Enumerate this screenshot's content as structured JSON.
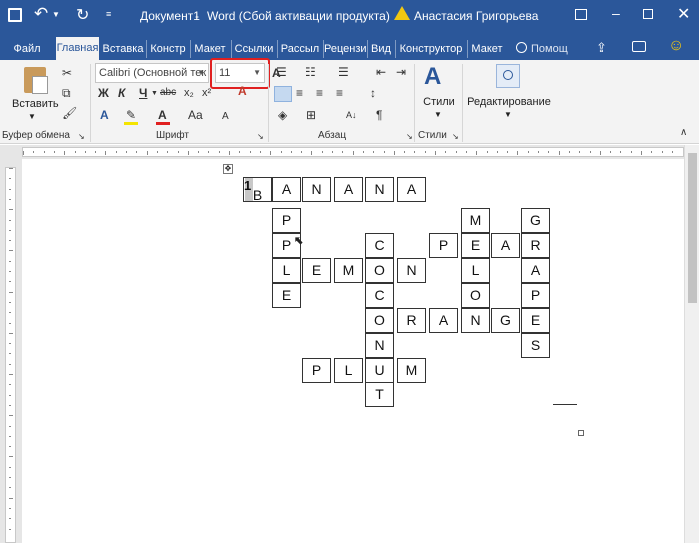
{
  "window": {
    "doc_title": "Документ1",
    "app_title": "Word (Сбой активации продукта)",
    "user_name": "Анастасия Григорьева"
  },
  "tabs": [
    "Файл",
    "Главная",
    "Вставка",
    "Констр",
    "Макет",
    "Ссылки",
    "Рассыл",
    "Рецензи",
    "Вид",
    "Конструктор",
    "Макет"
  ],
  "active_tab": "Главная",
  "search": {
    "placeholder": "Помощ"
  },
  "ribbon": {
    "paste_label": "Вставить",
    "clipboard_group": "Буфер обмена",
    "font_group": "Шрифт",
    "paragraph_group": "Абзац",
    "styles_group": "Стили",
    "font_name": "Calibri (Основной тек",
    "font_size": "11",
    "bold": "Ж",
    "italic": "К",
    "underline": "Ч",
    "strike": "abc",
    "subscript": "x₂",
    "superscript": "x²",
    "case_label": "Aa",
    "grow_font": "A",
    "shrink_font": "A",
    "styles_label": "Стили",
    "editing_label": "Редактирование"
  },
  "colors": {
    "titlebar": "#2b579a",
    "highlight_box": "#e02020"
  },
  "crossword": {
    "number_label": "1",
    "rows": [
      [
        "B",
        "A",
        "N",
        "A",
        "N",
        "A"
      ],
      [
        "P",
        "M",
        "G"
      ],
      [
        "P",
        "C",
        "P",
        "E",
        "A",
        "R",
        "R"
      ],
      [
        "L",
        "E",
        "M",
        "O",
        "N",
        "L",
        "A"
      ],
      [
        "E",
        "C",
        "O",
        "P"
      ],
      [
        "O",
        "R",
        "A",
        "N",
        "G",
        "E"
      ],
      [
        "N",
        "S"
      ],
      [
        "P",
        "L",
        "U",
        "M"
      ],
      [
        "T"
      ]
    ]
  }
}
